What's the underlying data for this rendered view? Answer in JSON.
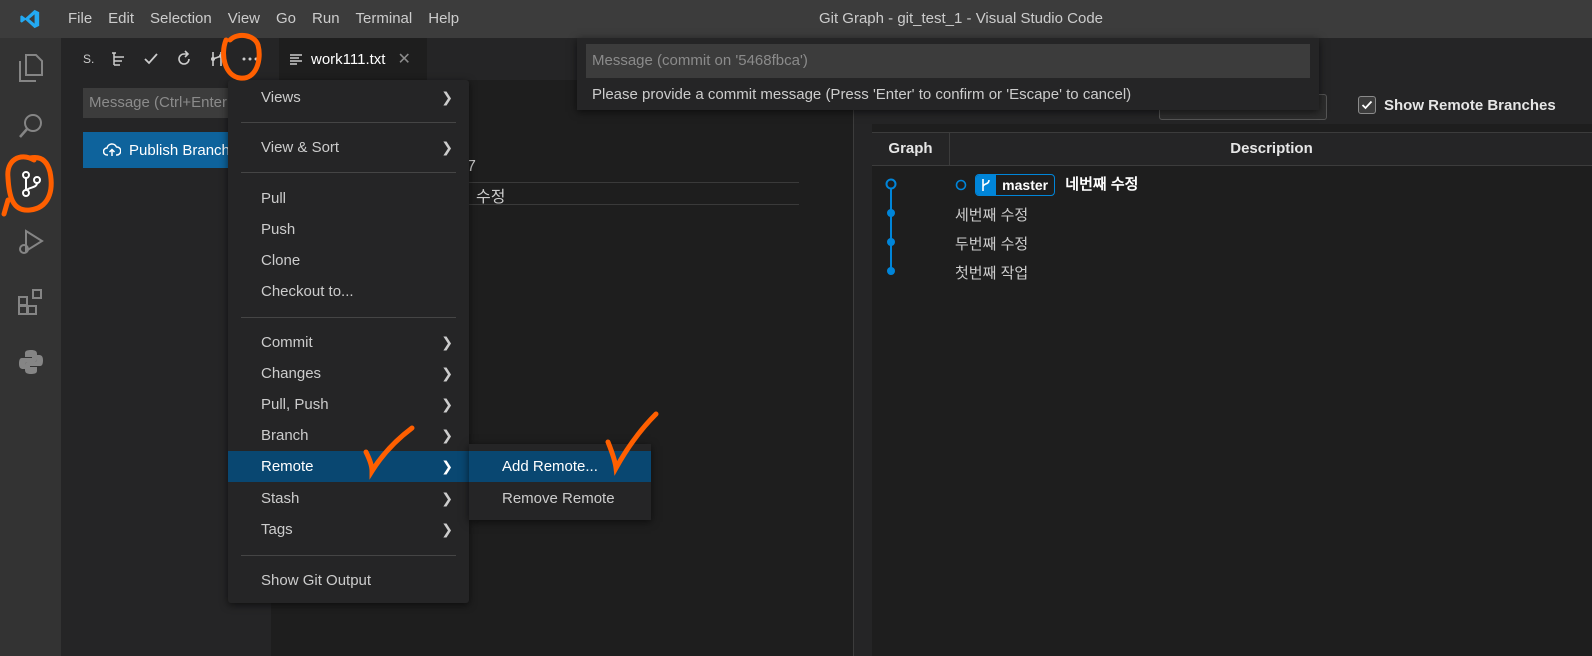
{
  "window": {
    "title": "Git Graph - git_test_1 - Visual Studio Code"
  },
  "menubar": [
    "File",
    "Edit",
    "Selection",
    "View",
    "Go",
    "Run",
    "Terminal",
    "Help"
  ],
  "sidebar": {
    "title": "S.",
    "message_placeholder": "Message (Ctrl+Enter",
    "publish_label": "Publish Branch"
  },
  "editor": {
    "tab_label": "work111.txt",
    "text_fragment_1": "7",
    "text_fragment_2": "수정"
  },
  "quick_input": {
    "placeholder": "Message (commit on '5468fbca')",
    "message": "Please provide a commit message (Press 'Enter' to confirm or 'Escape' to cancel)"
  },
  "context_menu": {
    "items": [
      {
        "label": "Views"
      },
      {
        "label": "View & Sort"
      },
      {
        "label": "Pull"
      },
      {
        "label": "Push"
      },
      {
        "label": "Clone"
      },
      {
        "label": "Checkout to..."
      },
      {
        "label": "Commit"
      },
      {
        "label": "Changes"
      },
      {
        "label": "Pull, Push"
      },
      {
        "label": "Branch"
      },
      {
        "label": "Remote"
      },
      {
        "label": "Stash"
      },
      {
        "label": "Tags"
      },
      {
        "label": "Show Git Output"
      }
    ],
    "submenu": [
      {
        "label": "Add Remote..."
      },
      {
        "label": "Remove Remote"
      }
    ]
  },
  "git_graph": {
    "show_remote_label": "Show Remote Branches",
    "col_graph": "Graph",
    "col_description": "Description",
    "branch_name": "master",
    "commits": [
      "네번째 수정",
      "세번째 수정",
      "두번째 수정",
      "첫번째 작업"
    ],
    "graph_color": "#0085d9"
  },
  "annotation_color": "#ff5f00"
}
